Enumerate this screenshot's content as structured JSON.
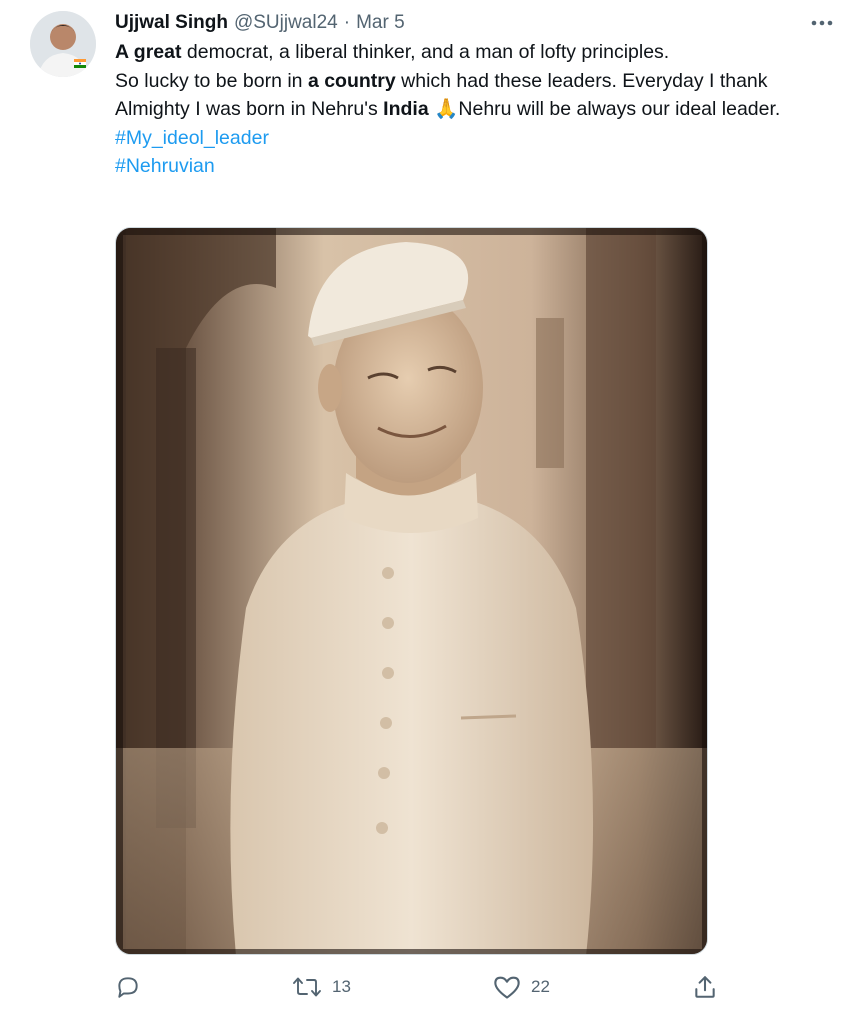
{
  "tweet": {
    "author": {
      "display_name": "Ujjwal Singh",
      "handle": "@SUjjwal24",
      "avatar_icon": "user-avatar"
    },
    "separator": "·",
    "date": "Mar 5",
    "more_icon": "more-horizontal-icon",
    "text": {
      "line1_bold": "A great",
      "line1_rest": " democrat, a liberal thinker, and a man of lofty principles.",
      "line2_pre": "So lucky to be born in ",
      "line2_bold": "a country",
      "line2_post": " which had these leaders. Everyday I thank Almighty I was born in Nehru's ",
      "line2_bold2": "India",
      "emoji": "🙏",
      "line2_end": "Nehru will be always our ideal leader."
    },
    "hashtags": [
      "#My_ideol_leader",
      "#Nehruvian"
    ],
    "actions": {
      "reply": {
        "icon": "reply-icon",
        "count": ""
      },
      "retweet": {
        "icon": "retweet-icon",
        "count": "13"
      },
      "like": {
        "icon": "heart-icon",
        "count": "22"
      },
      "share": {
        "icon": "share-icon",
        "count": ""
      }
    },
    "colors": {
      "link": "#1d9bf0",
      "secondary_text": "#536471",
      "primary_text": "#0f1419"
    }
  }
}
